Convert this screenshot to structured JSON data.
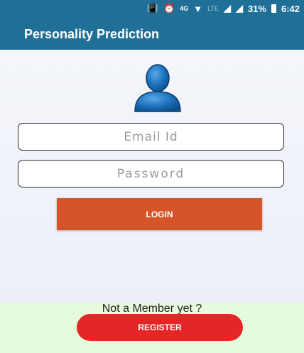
{
  "status_bar": {
    "network": "4G",
    "lte": "LTE",
    "battery": "31%",
    "time": "6:42"
  },
  "app_bar": {
    "title": "Personality Prediction"
  },
  "login_form": {
    "email_placeholder": "Email Id",
    "password_placeholder": "Password",
    "login_label": "LOGIN"
  },
  "footer": {
    "prompt": "Not a Member yet ?",
    "register_label": "REGISTER"
  },
  "colors": {
    "app_bar": "#1f6f96",
    "login_button": "#d6542a",
    "register_button": "#e42626",
    "footer_bg": "#e6fadc",
    "avatar": "#1a6fb8"
  }
}
